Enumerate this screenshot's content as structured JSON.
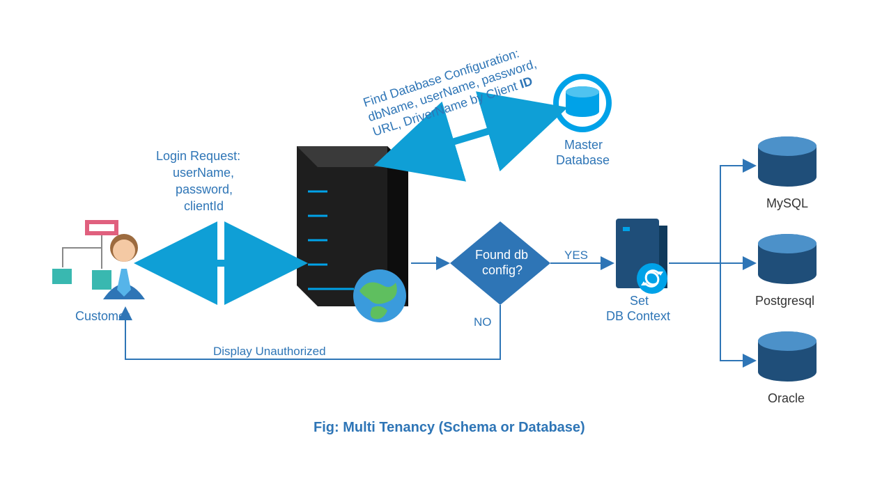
{
  "caption": "Fig: Multi Tenancy (Schema or Database)",
  "nodes": {
    "customer": "Customer",
    "master_db": "Master\nDatabase",
    "decision": "Found db\nconfig?",
    "set_ctx": "Set\nDB Context",
    "db_mysql": "MySQL",
    "db_postgresql": "Postgresql",
    "db_oracle": "Oracle"
  },
  "edges": {
    "login": "Login Request:\nuserName,\npassword,\nclientId",
    "find_cfg": "Find Database Configuration:\ndbName, userName, password,\nURL, DriverName by Client ID",
    "yes": "YES",
    "no": "NO",
    "unauth": "Display Unauthorized"
  },
  "colors": {
    "blue": "#2e75b6",
    "darkBlue": "#1f4e79",
    "cyan": "#00a2e8",
    "serverDark": "#2b2b2b",
    "globeBlue": "#3a9bdc",
    "globeGreen": "#5fbf5f"
  }
}
